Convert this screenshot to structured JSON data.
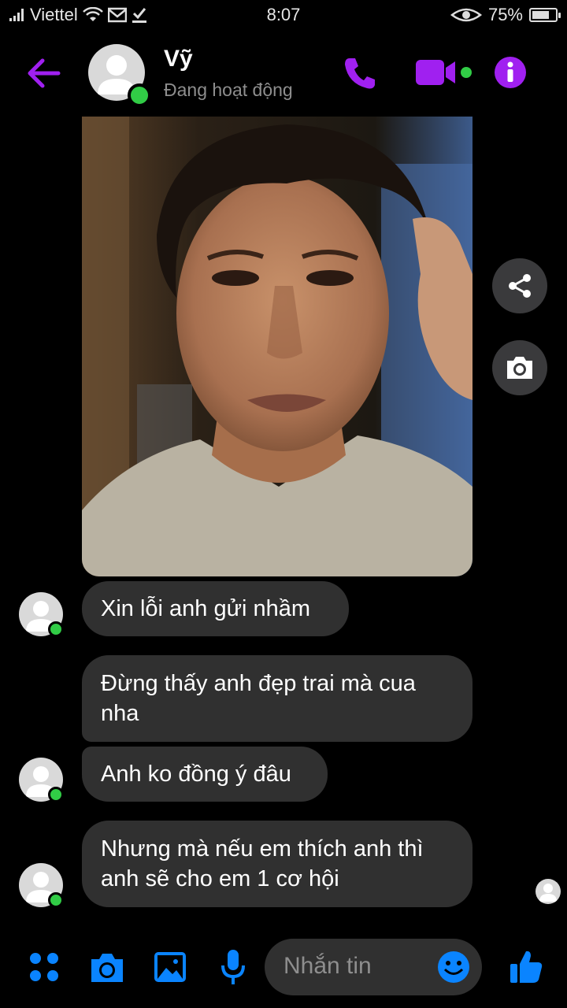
{
  "status_bar": {
    "carrier": "Viettel",
    "time": "8:07",
    "battery": "75%",
    "battery_fraction": 0.75
  },
  "header": {
    "contact_name": "Vỹ",
    "presence": "Đang hoạt động",
    "icons": [
      "back-arrow-icon",
      "phone-icon",
      "video-camera-icon",
      "info-icon"
    ]
  },
  "messages": [
    {
      "text": "Xin lỗi anh gửi nhầm"
    },
    {
      "text": "Đừng thấy anh đẹp trai mà cua nha"
    },
    {
      "text": "Anh ko đồng ý đâu"
    },
    {
      "text": "Nhưng mà nếu em thích anh thì anh sẽ cho em 1 cơ hội"
    }
  ],
  "composer": {
    "placeholder": "Nhắn tin"
  },
  "colors": {
    "accent_purple": "#a020f0",
    "accent_blue": "#0a84ff",
    "online_green": "#31cc46",
    "bubble": "#303030"
  }
}
